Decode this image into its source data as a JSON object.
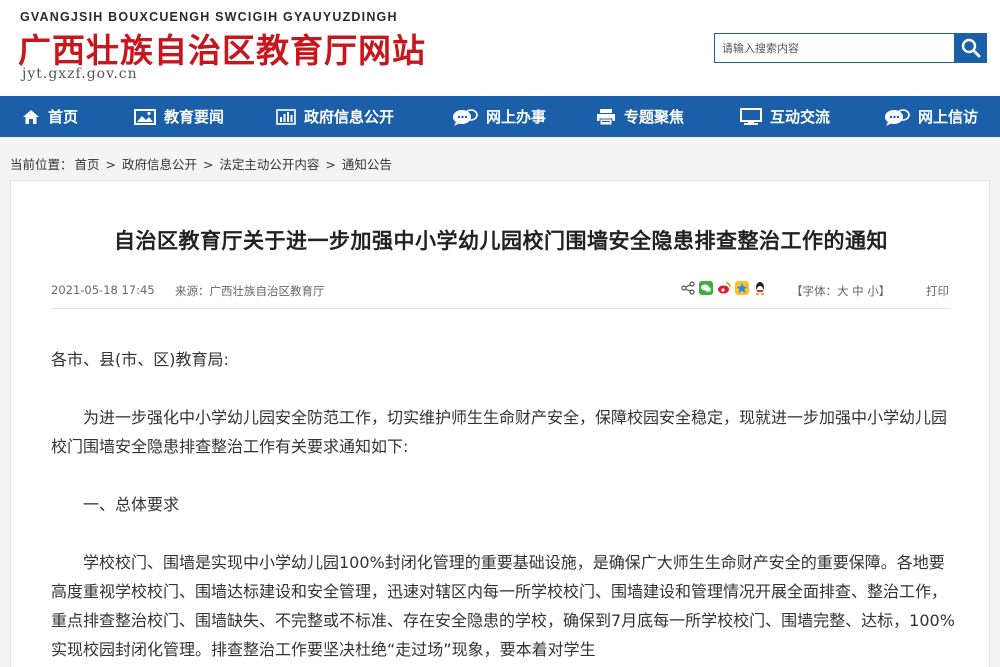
{
  "header": {
    "pinyin": "GVANGJSIH BOUXCUENGH SWCIGIH GYAUYUZDINGH",
    "site_name": "广西壮族自治区教育厅网站",
    "url": "jyt.gxzf.gov.cn",
    "search_placeholder": "请输入搜索内容"
  },
  "nav": {
    "items": [
      {
        "label": "首页",
        "icon": "home-icon"
      },
      {
        "label": "教育要闻",
        "icon": "image-icon"
      },
      {
        "label": "政府信息公开",
        "icon": "bar-chart-icon"
      },
      {
        "label": "网上办事",
        "icon": "chat-icon"
      },
      {
        "label": "专题聚焦",
        "icon": "printer-icon"
      },
      {
        "label": "互动交流",
        "icon": "monitor-icon"
      },
      {
        "label": "网上信访",
        "icon": "chat-icon"
      }
    ]
  },
  "breadcrumb": {
    "prefix": "当前位置：",
    "items": [
      "首页",
      "政府信息公开",
      "法定主动公开内容",
      "通知公告"
    ],
    "separator": " > "
  },
  "article": {
    "title": "自治区教育厅关于进一步加强中小学幼儿园校门围墙安全隐患排查整治工作的通知",
    "date": "2021-05-18 17:45",
    "source": "来源：广西壮族自治区教育厅",
    "font_size_label": "【字体：大 中 小】",
    "print_label": "打印",
    "paragraphs": {
      "salutation": "各市、县(市、区)教育局:",
      "intro": "为进一步强化中小学幼儿园安全防范工作，切实维护师生生命财产安全，保障校园安全稳定，现就进一步加强中小学幼儿园校门围墙安全隐患排查整治工作有关要求通知如下:",
      "section1": "一、总体要求",
      "body1": "学校校门、围墙是实现中小学幼儿园100%封闭化管理的重要基础设施，是确保广大师生生命财产安全的重要保障。各地要高度重视学校校门、围墙达标建设和安全管理，迅速对辖区内每一所学校校门、围墙建设和管理情况开展全面排查、整治工作，重点排查整治校门、围墙缺失、不完整或不标准、存在安全隐患的学校，确保到7月底每一所学校校门、围墙完整、达标，100%实现校园封闭化管理。排查整治工作要坚决杜绝“走过场”现象，要本着对学生"
    }
  },
  "colors": {
    "brand_red": "#c8161d",
    "nav_blue": "#1a5fa8"
  }
}
